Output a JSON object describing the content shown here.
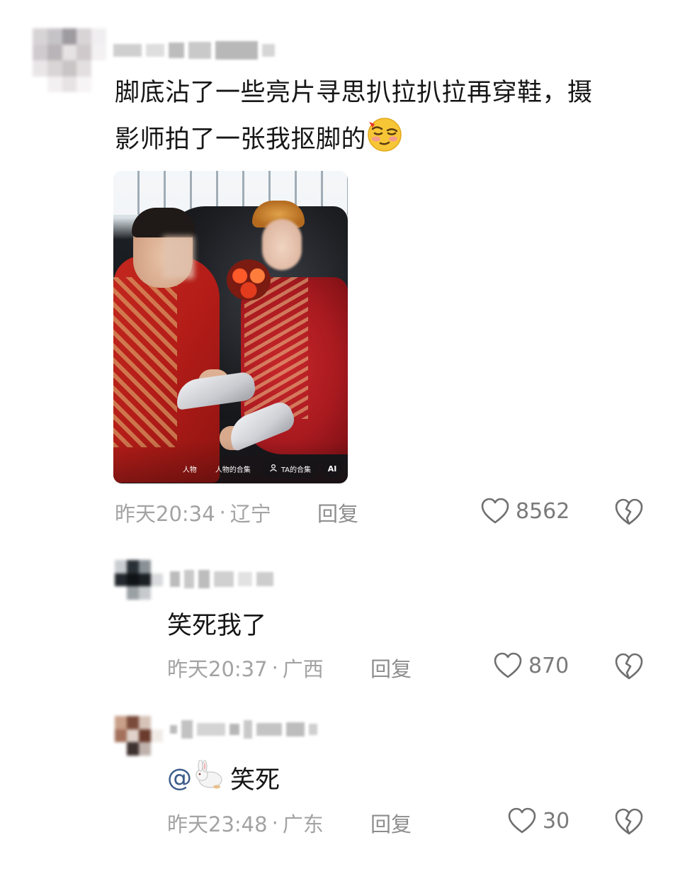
{
  "comments": [
    {
      "text_line1": "脚底沾了一些亮片寻思扒拉扒拉再穿鞋，摄",
      "text_line2": "影师拍了一张我抠脚的",
      "emoji": "smirk-blush-emoji",
      "photo_chips": [
        "人物",
        "人物的合集",
        "TA的合集",
        "AI"
      ],
      "time": "昨天20:34",
      "location": "辽宁",
      "reply_label": "回复",
      "likes": "8562"
    }
  ],
  "replies": [
    {
      "text": "笑死我了",
      "time": "昨天20:37",
      "location": "广西",
      "reply_label": "回复",
      "likes": "870"
    },
    {
      "mention": "@",
      "mention_emoji": "rabbit-emoji",
      "text": "笑死",
      "time": "昨天23:48",
      "location": "广东",
      "reply_label": "回复",
      "likes": "30"
    }
  ],
  "meta_separator": "·",
  "colors": {
    "text": "#161616",
    "meta": "#a3a3a3",
    "icon": "#7a7a7a",
    "background": "#ffffff"
  }
}
